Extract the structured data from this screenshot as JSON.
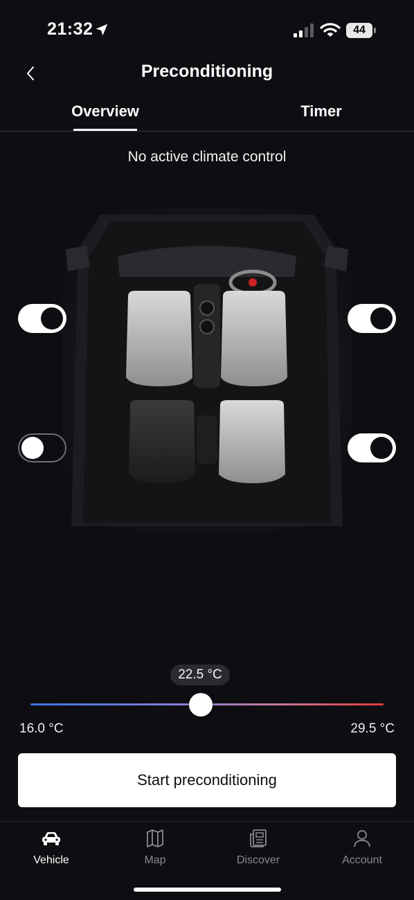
{
  "status_bar": {
    "time": "21:32",
    "battery_level": "44",
    "location_icon": "location-arrow-icon",
    "signal_icon": "cellular-signal-icon",
    "wifi_icon": "wifi-icon"
  },
  "header": {
    "title": "Preconditioning",
    "back_icon": "chevron-left-icon"
  },
  "tabs": [
    {
      "label": "Overview",
      "active": true
    },
    {
      "label": "Timer",
      "active": false
    }
  ],
  "climate_status": "No active climate control",
  "seats": {
    "front_left": {
      "enabled": true
    },
    "front_right": {
      "enabled": true
    },
    "rear_left": {
      "enabled": false
    },
    "rear_right": {
      "enabled": true
    }
  },
  "temperature": {
    "current": "22.5 °C",
    "min_label": "16.0 °C",
    "max_label": "29.5 °C",
    "value": 22.5,
    "min": 16.0,
    "max": 29.5
  },
  "start_button_label": "Start preconditioning",
  "bottom_nav": [
    {
      "label": "Vehicle",
      "icon": "car-icon",
      "active": true
    },
    {
      "label": "Map",
      "icon": "map-icon",
      "active": false
    },
    {
      "label": "Discover",
      "icon": "news-icon",
      "active": false
    },
    {
      "label": "Account",
      "icon": "user-icon",
      "active": false
    }
  ],
  "colors": {
    "background": "#0e0e12",
    "slider_cold": "#3d74e6",
    "slider_hot": "#e33a3a",
    "active_tab": "#ffffff",
    "inactive_nav": "#8a8a90"
  }
}
